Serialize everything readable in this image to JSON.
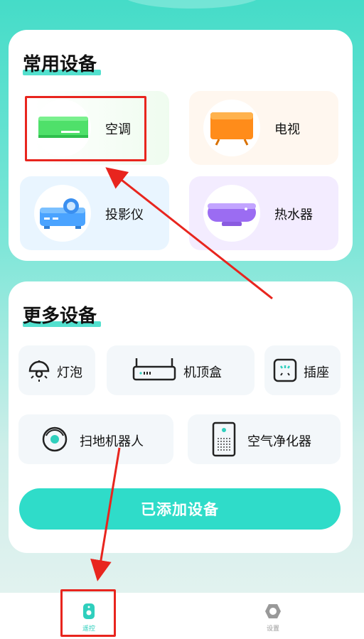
{
  "common": {
    "title": "常用设备",
    "items": [
      {
        "label": "空调",
        "icon": "air-conditioner-icon"
      },
      {
        "label": "电视",
        "icon": "tv-icon"
      },
      {
        "label": "投影仪",
        "icon": "projector-icon"
      },
      {
        "label": "热水器",
        "icon": "water-heater-icon"
      }
    ]
  },
  "more": {
    "title": "更多设备",
    "items": [
      {
        "label": "灯泡",
        "icon": "bulb-icon"
      },
      {
        "label": "机顶盒",
        "icon": "set-top-box-icon"
      },
      {
        "label": "插座",
        "icon": "socket-icon"
      },
      {
        "label": "扫地机器人",
        "icon": "robot-vacuum-icon"
      },
      {
        "label": "空气净化器",
        "icon": "air-purifier-icon"
      }
    ],
    "add_button": "已添加设备"
  },
  "tabbar": {
    "tabs": [
      {
        "label": "遥控",
        "icon": "remote-icon",
        "active": true
      },
      {
        "label": "设置",
        "icon": "gear-icon",
        "active": false
      }
    ]
  },
  "colors": {
    "accent": "#2fdcc9",
    "annotation_red": "#e8251e"
  }
}
